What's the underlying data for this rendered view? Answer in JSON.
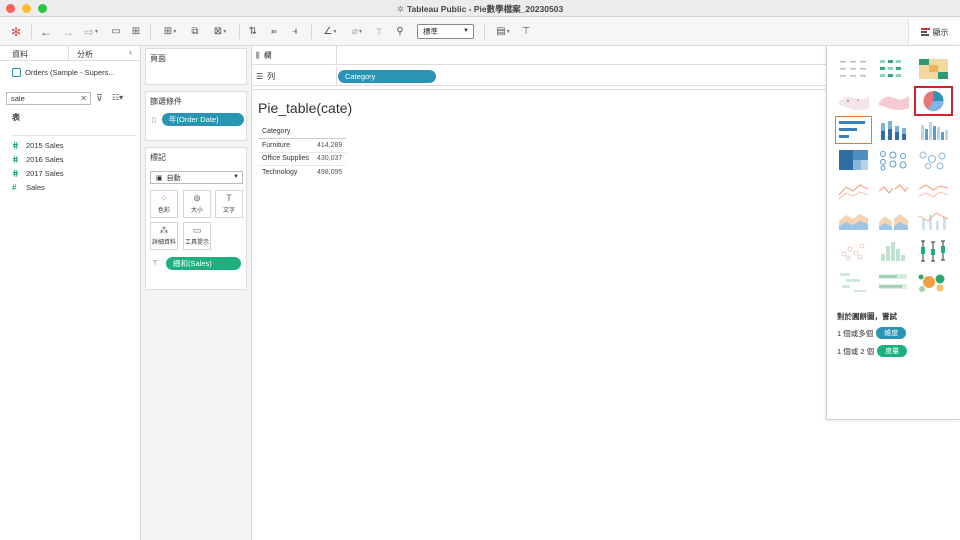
{
  "window": {
    "title": "Tableau Public - Pie數學檔案_20230503"
  },
  "toolbar": {
    "standard_select": "標準",
    "show_me_label": "顯示"
  },
  "left_pane": {
    "tabs": [
      "資料",
      "分析"
    ],
    "collapse_glyph": "‹",
    "data_source": "Orders (Sample - Supers...",
    "search_value": "sale",
    "clear_glyph": "✕",
    "table_heading": "表",
    "fields": [
      "2015 Sales",
      "2016 Sales",
      "2017 Sales",
      "Sales"
    ]
  },
  "shelves": {
    "pages_title": "頁面",
    "filters_title": "篩選條件",
    "filter_pill": "年(Order Date)",
    "marks_title": "標記",
    "marks_type": "自動",
    "mark_buttons": [
      "色彩",
      "大小",
      "文字",
      "詳細資料",
      "工具提示"
    ],
    "marks_pill": "總和(Sales)",
    "columns_label": "欄",
    "rows_label": "列",
    "rows_pill": "Category"
  },
  "sheet": {
    "title": "Pie_table(cate)",
    "column_header": "Category",
    "rows": [
      {
        "category": "Furniture",
        "value": "414,289"
      },
      {
        "category": "Office Supplies",
        "value": "430,037"
      },
      {
        "category": "Technology",
        "value": "498,095"
      }
    ]
  },
  "show_me": {
    "hint_title": "對於圓餅圖，嘗試",
    "line1_prefix": "1 個或多個",
    "line1_pill": "維度",
    "line2_prefix": "1 個或 2 個",
    "line2_pill": "度量"
  },
  "colors": {
    "accent_blue": "#2a94b3",
    "accent_green": "#1db07c",
    "selection_red": "#d0202a"
  }
}
